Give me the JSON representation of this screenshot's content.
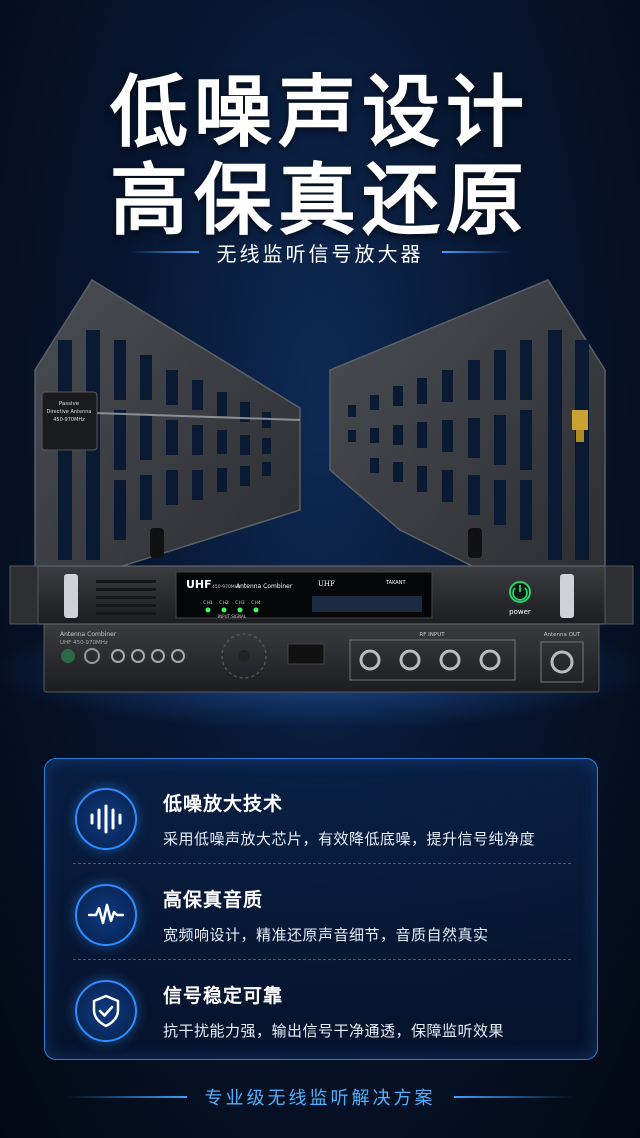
{
  "headline": {
    "line1": "低噪声设计",
    "line2": "高保真还原",
    "subtitle": "无线监听信号放大器"
  },
  "product": {
    "antenna_label_line1": "Passive",
    "antenna_label_line2": "Directive Antenna",
    "antenna_label_line3": "450-970MHz",
    "front_brand": "UHF",
    "front_freq": "450-970MHz",
    "front_model": "Antenna Combiner",
    "display_logo": "UHF",
    "display_brand": "TAKANT",
    "channels": [
      "CH1",
      "CH2",
      "CH3",
      "CH4"
    ],
    "input_signal": "INPUT SIGNAL",
    "power_label": "power",
    "rear_title": "Antenna Combiner",
    "rear_freq": "UHF 450-970MHz",
    "rf_input_label": "RF INPUT",
    "antenna_out_label": "Antenna OUT"
  },
  "features": [
    {
      "icon": "audio-wave-icon",
      "title": "低噪放大技术",
      "desc": "采用低噪声放大芯片，有效降低底噪，提升信号纯净度"
    },
    {
      "icon": "pulse-icon",
      "title": "高保真音质",
      "desc": "宽频响设计，精准还原声音细节，音质自然真实"
    },
    {
      "icon": "shield-check-icon",
      "title": "信号稳定可靠",
      "desc": "抗干扰能力强，输出信号干净通透，保障监听效果"
    }
  ],
  "footer": "专业级无线监听解决方案",
  "colors": {
    "accent": "#2f8cff",
    "footer_text": "#4fb0ff",
    "bg": "#071630"
  }
}
